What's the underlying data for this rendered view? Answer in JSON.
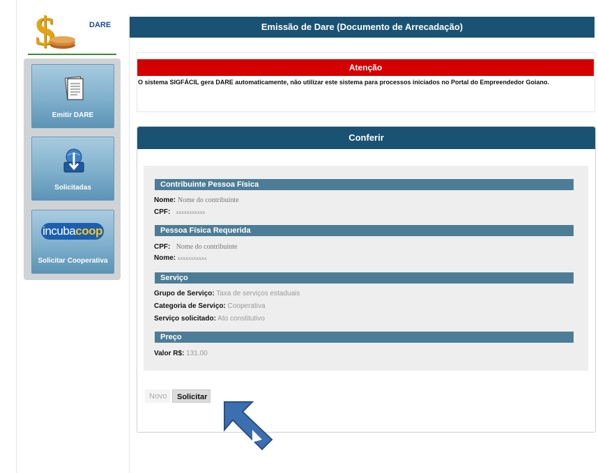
{
  "sidebar": {
    "logo_label": "DARE",
    "items": [
      {
        "label": "Emitir DARE",
        "icon": "document-icon"
      },
      {
        "label": "Solicitadas",
        "icon": "download-globe-icon"
      },
      {
        "label": "Solicitar Cooperativa",
        "icon": "incubacoop-logo",
        "logo_text_a": "incuba",
        "logo_text_b": "coop"
      }
    ]
  },
  "header": {
    "title": "Emissão de Dare (Documento de Arrecadação)"
  },
  "notice": {
    "title": "Atenção",
    "text": "O sistema SIGFÁCIL gera DARE automaticamente, não utilizar este sistema para processos iniciados no Portal do Empreendedor Goiano."
  },
  "card": {
    "title": "Conferir",
    "sections": {
      "contribuinte": {
        "title": "Contribuinte Pessoa Física",
        "nome_label": "Nome:",
        "nome_value": "Nome do contribuinte",
        "cpf_label": "CPF:",
        "cpf_value": "xxxxxxxxxxx"
      },
      "requerida": {
        "title": "Pessoa Física Requerida",
        "cpf_label": "CPF:",
        "cpf_value": "Nome do contribuinte",
        "nome_label": "Nome:",
        "nome_value": "xxxxxxxxxxx"
      },
      "servico": {
        "title": "Serviço",
        "grupo_label": "Grupo de Serviço:",
        "grupo_value": "Taxa de serviços estaduais",
        "categoria_label": "Categoria de Serviço:",
        "categoria_value": "Cooperativa",
        "solicitado_label": "Serviço solicitado:",
        "solicitado_value": "Ato constitutivo"
      },
      "preco": {
        "title": "Preço",
        "valor_label": "Valor R$:",
        "valor_value": "131.00"
      }
    },
    "buttons": {
      "novo": "Novo",
      "solicitar": "Solicitar"
    }
  },
  "colors": {
    "header_bg": "#1a5273",
    "notice_bg": "#d40000",
    "section_bg": "#4d7d96",
    "sidebar_btn": "#7fb0cc",
    "pointer_arrow": "#3b6fb0"
  }
}
